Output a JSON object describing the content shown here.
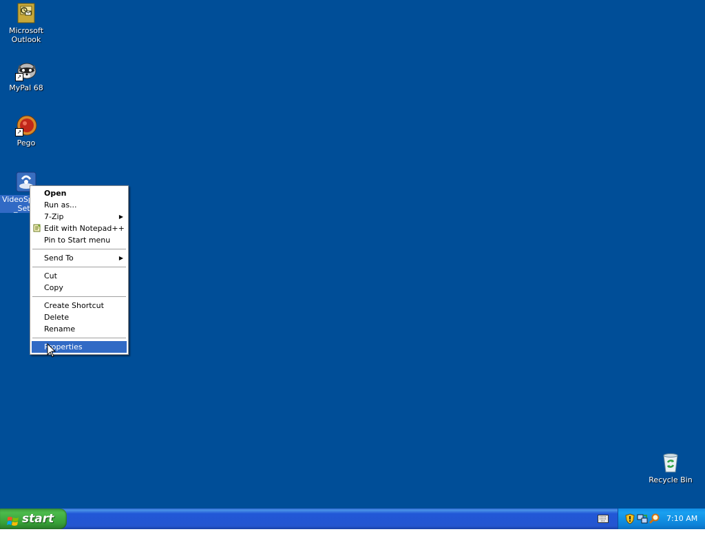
{
  "desktop": {
    "background_color": "#004e98",
    "icons": [
      {
        "label": "Microsoft\nOutlook",
        "icon": "outlook-icon"
      },
      {
        "label": "MyPal 68",
        "icon": "mypal-raccoon-icon"
      },
      {
        "label": "Pego",
        "icon": "pego-icon"
      },
      {
        "label_line1": "VideoSpi",
        "label_line2": "_Set",
        "icon": "videospin-setup-icon"
      },
      {
        "label": "Recycle Bin",
        "icon": "recycle-bin-icon"
      }
    ]
  },
  "context_menu": {
    "items": [
      {
        "label": "Open",
        "bold": true
      },
      {
        "label": "Run as..."
      },
      {
        "label": "7-Zip",
        "submenu": true
      },
      {
        "label": "Edit with Notepad++",
        "icon": "notepad-plus-plus-icon"
      },
      {
        "label": "Pin to Start menu"
      },
      {
        "label": "Send To",
        "submenu": true
      },
      {
        "label": "Cut"
      },
      {
        "label": "Copy"
      },
      {
        "label": "Create Shortcut"
      },
      {
        "label": "Delete"
      },
      {
        "label": "Rename"
      },
      {
        "label": "Properties",
        "selected": true
      }
    ],
    "submenu_arrow": "▶",
    "highlight_color": "#316ac5"
  },
  "taskbar": {
    "start_label": "start",
    "clock": "7:10 AM",
    "tray_icons": [
      "keyboard-icon",
      "security-shield-icon",
      "network-icon",
      "search-icon"
    ]
  }
}
